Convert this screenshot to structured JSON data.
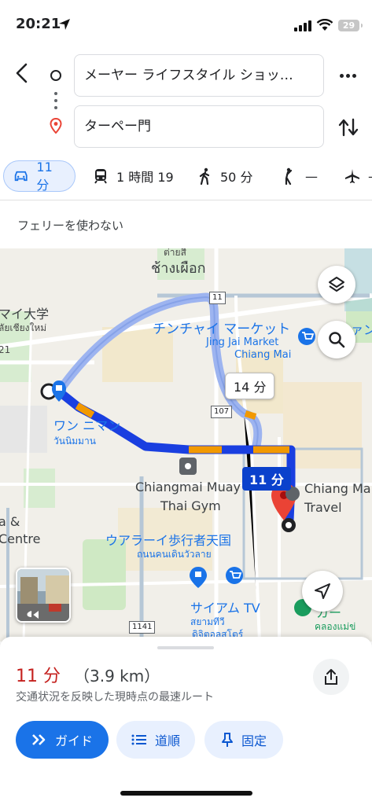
{
  "status_bar": {
    "time": "20:21",
    "battery": "29"
  },
  "search": {
    "origin": "メーヤー ライフスタイル ショッ…",
    "destination": "ターペー門"
  },
  "modes": [
    {
      "icon": "car-icon",
      "label": "11 分",
      "active": true
    },
    {
      "icon": "transit-icon",
      "label": "1 時間 19"
    },
    {
      "icon": "walk-icon",
      "label": "50 分"
    },
    {
      "icon": "ride-hail-icon",
      "label": "—"
    },
    {
      "icon": "flight-icon",
      "label": "—"
    }
  ],
  "route_options": "フェリーを使わない",
  "map": {
    "labels": {
      "thai_north": "ช้างเผือก",
      "thai_north_top": "ต่ายสี",
      "university": "マイ大学",
      "university_thai": "ลัยเชียงใหม่",
      "chinchai": "チンチャイ マーケット",
      "jingjai_1": "Jing Jai Market",
      "jingjai_2": "Chiang Mai",
      "one_nimman": "ワン ニマン",
      "one_nimman_thai": "วันนิมมาน",
      "muay_1": "Chiangmai Muay",
      "muay_2": "Thai Gym",
      "travel_1": "Chiang Ma",
      "travel_2": "Travel",
      "walking_street": "ウアラーイ歩行者天国",
      "walking_street_thai": "ถนนคนเดินวัวลาย",
      "siam_tv": "サイアム TV",
      "siam_tv_thai_1": "สยามทีวี",
      "siam_tv_thai_2": "ดิจิตอลสโตร์",
      "left_a": "a &",
      "left_centre": "Centre",
      "right_market": "カー",
      "right_market_thai": "คลองแม่ข่",
      "right_top": "ァン",
      "left_road_num": "21"
    },
    "shields": {
      "r11": "11",
      "r107": "107",
      "r1141": "1141"
    },
    "callouts": {
      "alt_route": "14 分",
      "main_route": "11 分"
    },
    "colors": {
      "route_main": "#1a3fe0",
      "route_alt": "#9db4f0",
      "traffic_slow": "#f29900",
      "destination_pin": "#ea4335"
    }
  },
  "sheet": {
    "duration": "11 分",
    "distance": "（3.9 km）",
    "description": "交通状況を反映した現時点の最速ルート",
    "buttons": {
      "guide": "ガイド",
      "steps": "道順",
      "pin": "固定"
    }
  }
}
